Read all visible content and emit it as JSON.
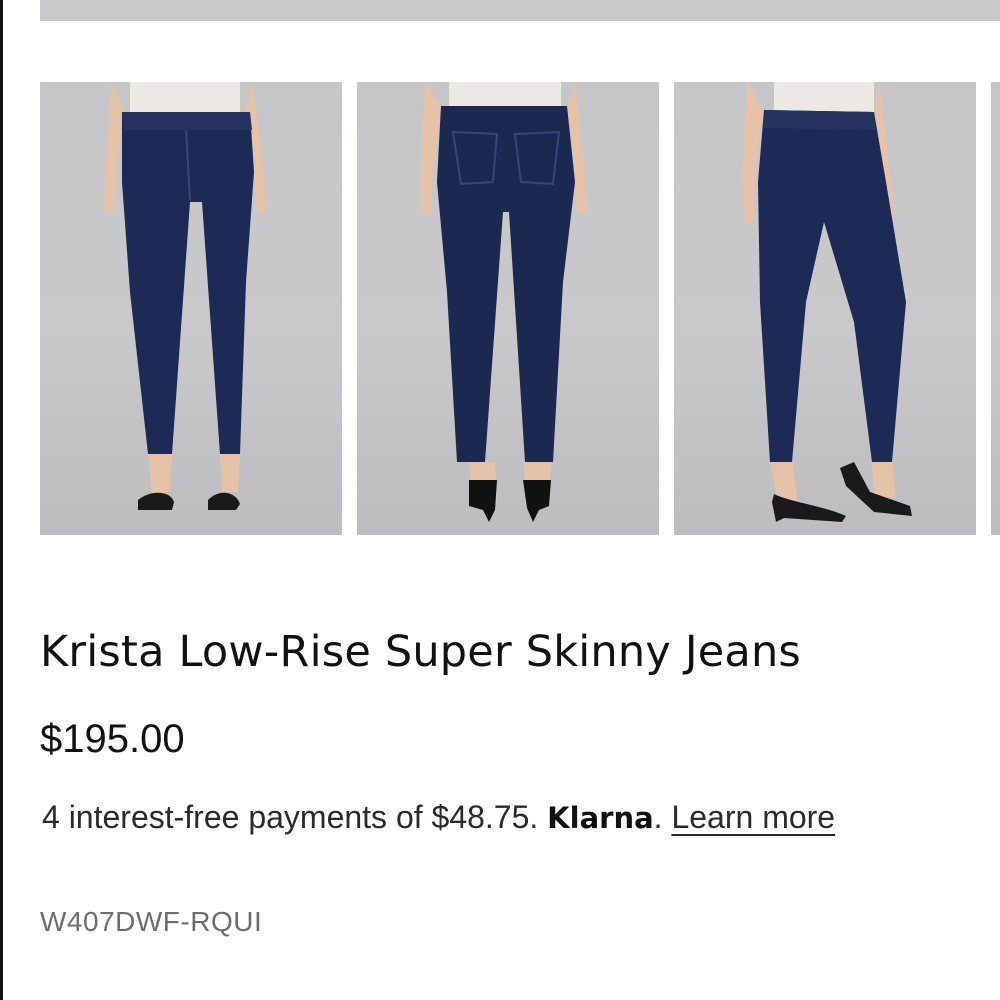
{
  "product": {
    "title": "Krista Low-Rise Super Skinny Jeans",
    "price": "$195.00",
    "payments": {
      "prefix": "4 interest-free payments of $48.75.",
      "provider": "Klarna",
      "provider_suffix": ".",
      "learn_more": "Learn more"
    },
    "sku": "W407DWF-RQUI"
  },
  "gallery": {
    "images": [
      {
        "view": "front",
        "icon": "jeans-front-photo"
      },
      {
        "view": "back",
        "icon": "jeans-back-photo"
      },
      {
        "view": "side",
        "icon": "jeans-side-photo"
      },
      {
        "view": "partial",
        "icon": "jeans-photo"
      }
    ]
  },
  "colors": {
    "denim": "#1c2a55",
    "background": "#c8c7ca",
    "text": "#111111",
    "muted": "#6d6d6d"
  }
}
